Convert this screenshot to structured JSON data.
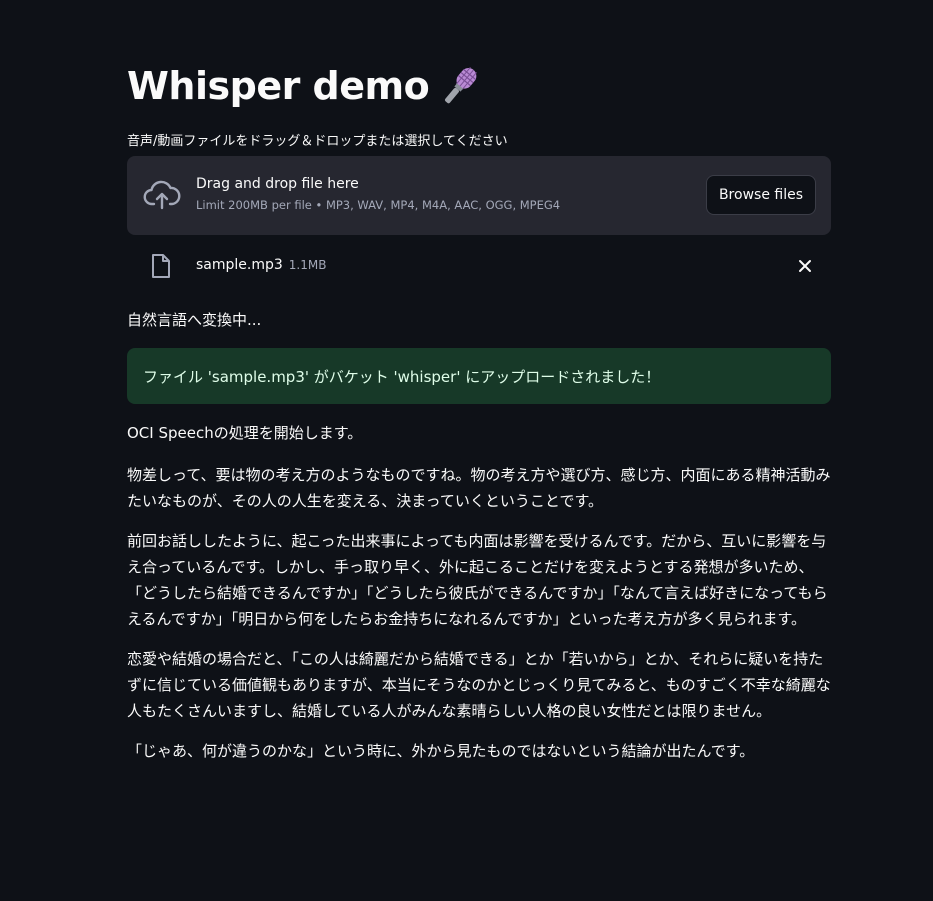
{
  "title": "Whisper demo",
  "title_emoji": "microphone-icon",
  "uploader": {
    "label": "音声/動画ファイルをドラッグ＆ドロップまたは選択してください",
    "dropzone_title": "Drag and drop file here",
    "dropzone_limit": "Limit 200MB per file • MP3, WAV, MP4, M4A, AAC, OGG, MPEG4",
    "browse_label": "Browse files",
    "uploaded_file": {
      "name": "sample.mp3",
      "size": "1.1MB"
    }
  },
  "status": "自然言語へ変換中...",
  "success_message": "ファイル 'sample.mp3' がバケット 'whisper' にアップロードされました！",
  "oci_status": "OCI Speechの処理を開始します。",
  "transcript": [
    "物差しって、要は物の考え方のようなものですね。物の考え方や選び方、感じ方、内面にある精神活動みたいなものが、その人の人生を変える、決まっていくということです。",
    "前回お話ししたように、起こった出来事によっても内面は影響を受けるんです。だから、互いに影響を与え合っているんです。しかし、手っ取り早く、外に起こることだけを変えようとする発想が多いため、「どうしたら結婚できるんですか」「どうしたら彼氏ができるんですか」「なんて言えば好きになってもらえるんですか」「明日から何をしたらお金持ちになれるんですか」といった考え方が多く見られます。",
    "恋愛や結婚の場合だと、「この人は綺麗だから結婚できる」とか「若いから」とか、それらに疑いを持たずに信じている価値観もありますが、本当にそうなのかとじっくり見てみると、ものすごく不幸な綺麗な人もたくさんいますし、結婚している人がみんな素晴らしい人格の良い女性だとは限りません。",
    "「じゃあ、何が違うのかな」という時に、外から見たものではないという結論が出たんです。"
  ],
  "colors": {
    "background": "#0e1117",
    "dropzone": "#262730",
    "success_bg": "#173928",
    "success_text": "#dffde9",
    "muted_text": "#a3a8b8"
  }
}
